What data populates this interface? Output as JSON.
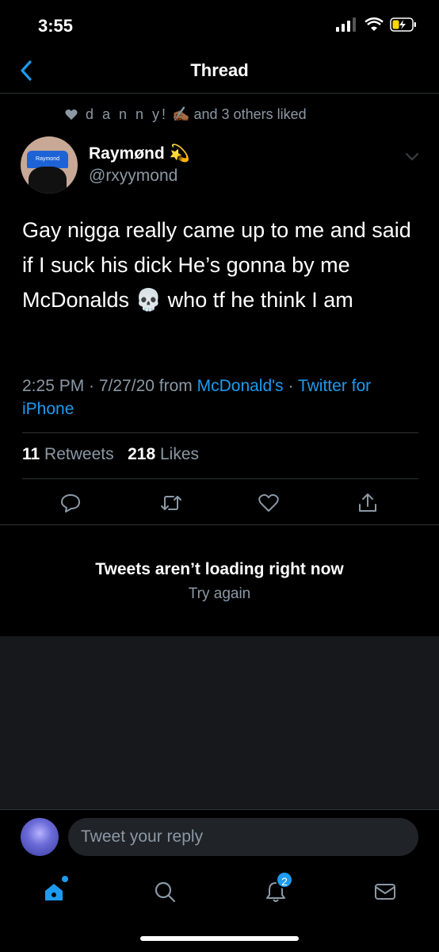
{
  "status_bar": {
    "time": "3:55"
  },
  "nav": {
    "title": "Thread"
  },
  "liked": {
    "name": "d a n n y!",
    "emoji": "✍🏾",
    "rest": "and 3 others liked"
  },
  "author": {
    "display_name": "Raymønd",
    "name_emoji": "💫",
    "handle": "@rxyymond",
    "cap_text": "Raymond"
  },
  "tweet": {
    "text": "Gay nigga really came up to me and said if I suck his dick He’s gonna by me McDonalds 💀 who tf he think I am",
    "time": "2:25 PM · 7/27/20 from ",
    "location": "McDonald's",
    "separator": " · ",
    "source": "Twitter for iPhone"
  },
  "stats": {
    "retweets": "11",
    "retweets_label": "Retweets",
    "likes": "218",
    "likes_label": "Likes"
  },
  "error": {
    "title": "Tweets aren’t loading right now",
    "retry": "Try again"
  },
  "reply": {
    "placeholder": "Tweet your reply"
  },
  "tabbar": {
    "notifications_badge": "2"
  },
  "colors": {
    "accent": "#1d9bf0",
    "background": "#000000",
    "secondary_text": "#8b98a5"
  }
}
